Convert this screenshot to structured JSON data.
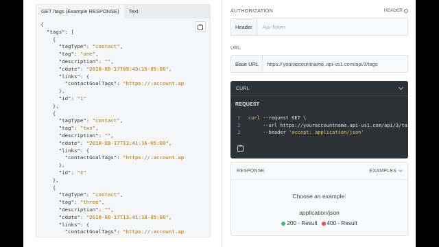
{
  "left_panel": {
    "tabs": [
      {
        "label": "GET /tags (Example RESPONSE)",
        "active": true
      },
      {
        "label": "Text",
        "active": false
      }
    ],
    "copy_icon": "clipboard-icon",
    "code_lines": [
      "{",
      "  \"tags\": [",
      "    {",
      "      \"tagType\": \"contact\",",
      "      \"tag\": \"one\",",
      "      \"description\": \"\",",
      "      \"cdate\": \"2018-08-17T09:43:15-05:00\",",
      "      \"links\": {",
      "        \"contactGoalTags\": \"https://:account.ap",
      "      },",
      "      \"id\": \"1\"",
      "    },",
      "    {",
      "      \"tagType\": \"contact\",",
      "      \"tag\": \"two\",",
      "      \"description\": \"\",",
      "      \"cdate\": \"2018-08-17T13:41:16-05:00\",",
      "      \"links\": {",
      "        \"contactGoalTags\": \"https://:account.ap",
      "      },",
      "      \"id\": \"2\"",
      "    },",
      "    {",
      "      \"tagType\": \"contact\",",
      "      \"tag\": \"three\",",
      "      \"description\": \"\",",
      "      \"cdate\": \"2018-08-17T13:41:18-05:00\",",
      "      \"links\": {",
      "        \"contactGoalTags\": \"https://:account.ap",
      "      },"
    ]
  },
  "authorization": {
    "title": "AUTHORIZATION",
    "header_toggle": "HEADER",
    "info_icon": "info-icon",
    "header_label": "Header",
    "header_placeholder": "Api-Token"
  },
  "url": {
    "title": "URL",
    "base_label": "Base URL",
    "base_prefix": "https://",
    "base_highlight": "youraccountname",
    "base_suffix": ".api-us1.com/api/3/tags"
  },
  "curl": {
    "title": "CURL",
    "chevron_icon": "chevron-down-icon",
    "request_label": "REQUEST",
    "lines": [
      {
        "n": "1",
        "cmd": "curl",
        "rest": " --request GET \\"
      },
      {
        "n": "2",
        "cmd": "",
        "rest": "     --url https://youraccountname.api-us1.com/api/3/ta"
      },
      {
        "n": "3",
        "cmd": "",
        "rest": "     --header ",
        "quoted": "'accept: application/json'"
      }
    ],
    "copy_icon": "clipboard-icon"
  },
  "response": {
    "title": "RESPONSE",
    "examples_label": "EXAMPLES",
    "choose_text": "Choose an example:",
    "mime": "application/json",
    "codes": [
      {
        "label": "200 - Result",
        "color": "#3fb68b"
      },
      {
        "label": "400 - Result",
        "color": "#d9534f"
      }
    ]
  }
}
